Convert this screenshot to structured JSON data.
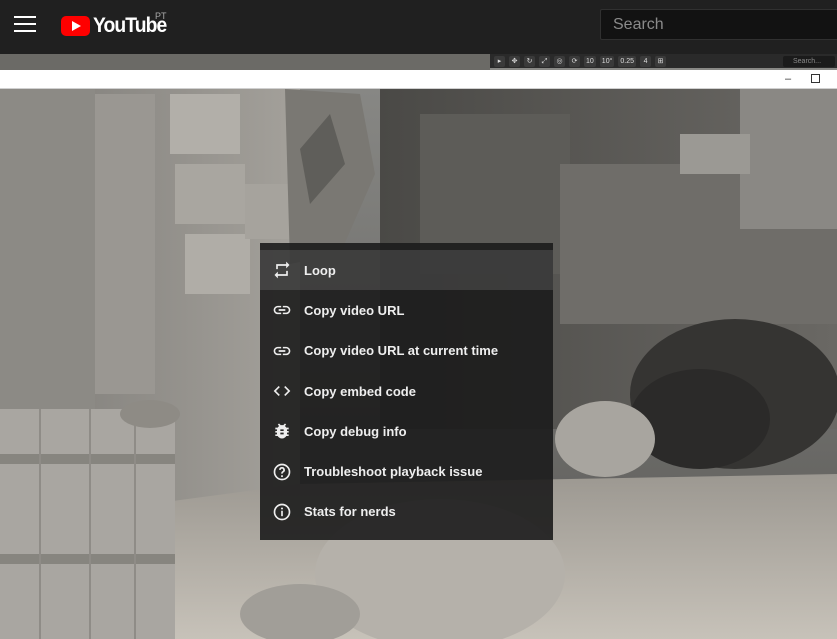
{
  "masthead": {
    "logo_text": "YouTube",
    "country_code": "PT",
    "search_placeholder": "Search"
  },
  "editor": {
    "toolbar_values": [
      "10",
      "10°",
      "0.25",
      "4"
    ],
    "toolbar_search_placeholder": "Search...",
    "window_minimize": "–"
  },
  "context_menu": {
    "items": [
      {
        "label": "Loop",
        "icon": "loop-icon"
      },
      {
        "label": "Copy video URL",
        "icon": "link-icon"
      },
      {
        "label": "Copy video URL at current time",
        "icon": "link-icon"
      },
      {
        "label": "Copy embed code",
        "icon": "code-icon"
      },
      {
        "label": "Copy debug info",
        "icon": "bug-icon"
      },
      {
        "label": "Troubleshoot playback issue",
        "icon": "help-circle-icon"
      },
      {
        "label": "Stats for nerds",
        "icon": "info-icon"
      }
    ]
  },
  "colors": {
    "brand_red": "#ff0000",
    "masthead_bg": "#202020",
    "menu_bg": "#1c1c1c"
  }
}
